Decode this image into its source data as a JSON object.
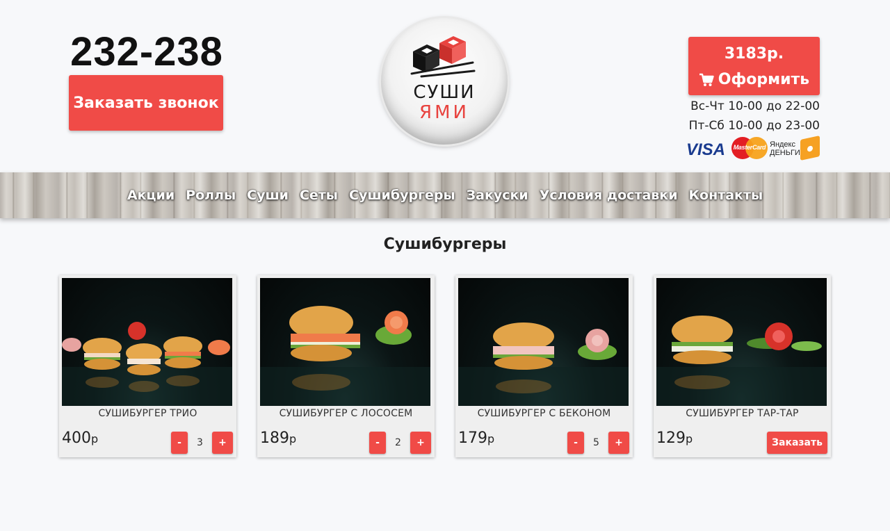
{
  "header": {
    "phone": "232-238",
    "callback_label": "Заказать звонок",
    "logo": {
      "line1": "СУШИ",
      "line2": "ЯМИ"
    },
    "cart": {
      "total": "3183р.",
      "checkout_label": "Оформить",
      "icon": "cart-icon"
    },
    "hours": [
      "Вс-Чт 10-00 до 22-00",
      "Пт-Сб 10-00 до 23-00"
    ],
    "payments": {
      "visa": "VISA",
      "mastercard": "MasterCard",
      "yandex_line1": "Яндекс",
      "yandex_line2": "ДЕНЬГИ"
    }
  },
  "nav": {
    "items": [
      "Акции",
      "Роллы",
      "Суши",
      "Сеты",
      "Сушибургеры",
      "Закуски",
      "Условия доставки",
      "Контакты"
    ]
  },
  "section": {
    "title": "Сушибургеры"
  },
  "products": [
    {
      "name": "СУШИБУРГЕР ТРИО",
      "price": "400",
      "currency": "р",
      "qty": "3",
      "minus": "-",
      "plus": "+"
    },
    {
      "name": "СУШИБУРГЕР С ЛОСОСЕМ",
      "price": "189",
      "currency": "р",
      "qty": "2",
      "minus": "-",
      "plus": "+"
    },
    {
      "name": "СУШИБУРГЕР С БЕКОНОМ",
      "price": "179",
      "currency": "р",
      "qty": "5",
      "minus": "-",
      "plus": "+"
    },
    {
      "name": "СУШИБУРГЕР ТАР-ТАР",
      "price": "129",
      "currency": "р",
      "order_label": "Заказать"
    }
  ],
  "colors": {
    "accent": "#f04b47",
    "background": "#f7f8fa",
    "logo_red": "#e8433f"
  }
}
